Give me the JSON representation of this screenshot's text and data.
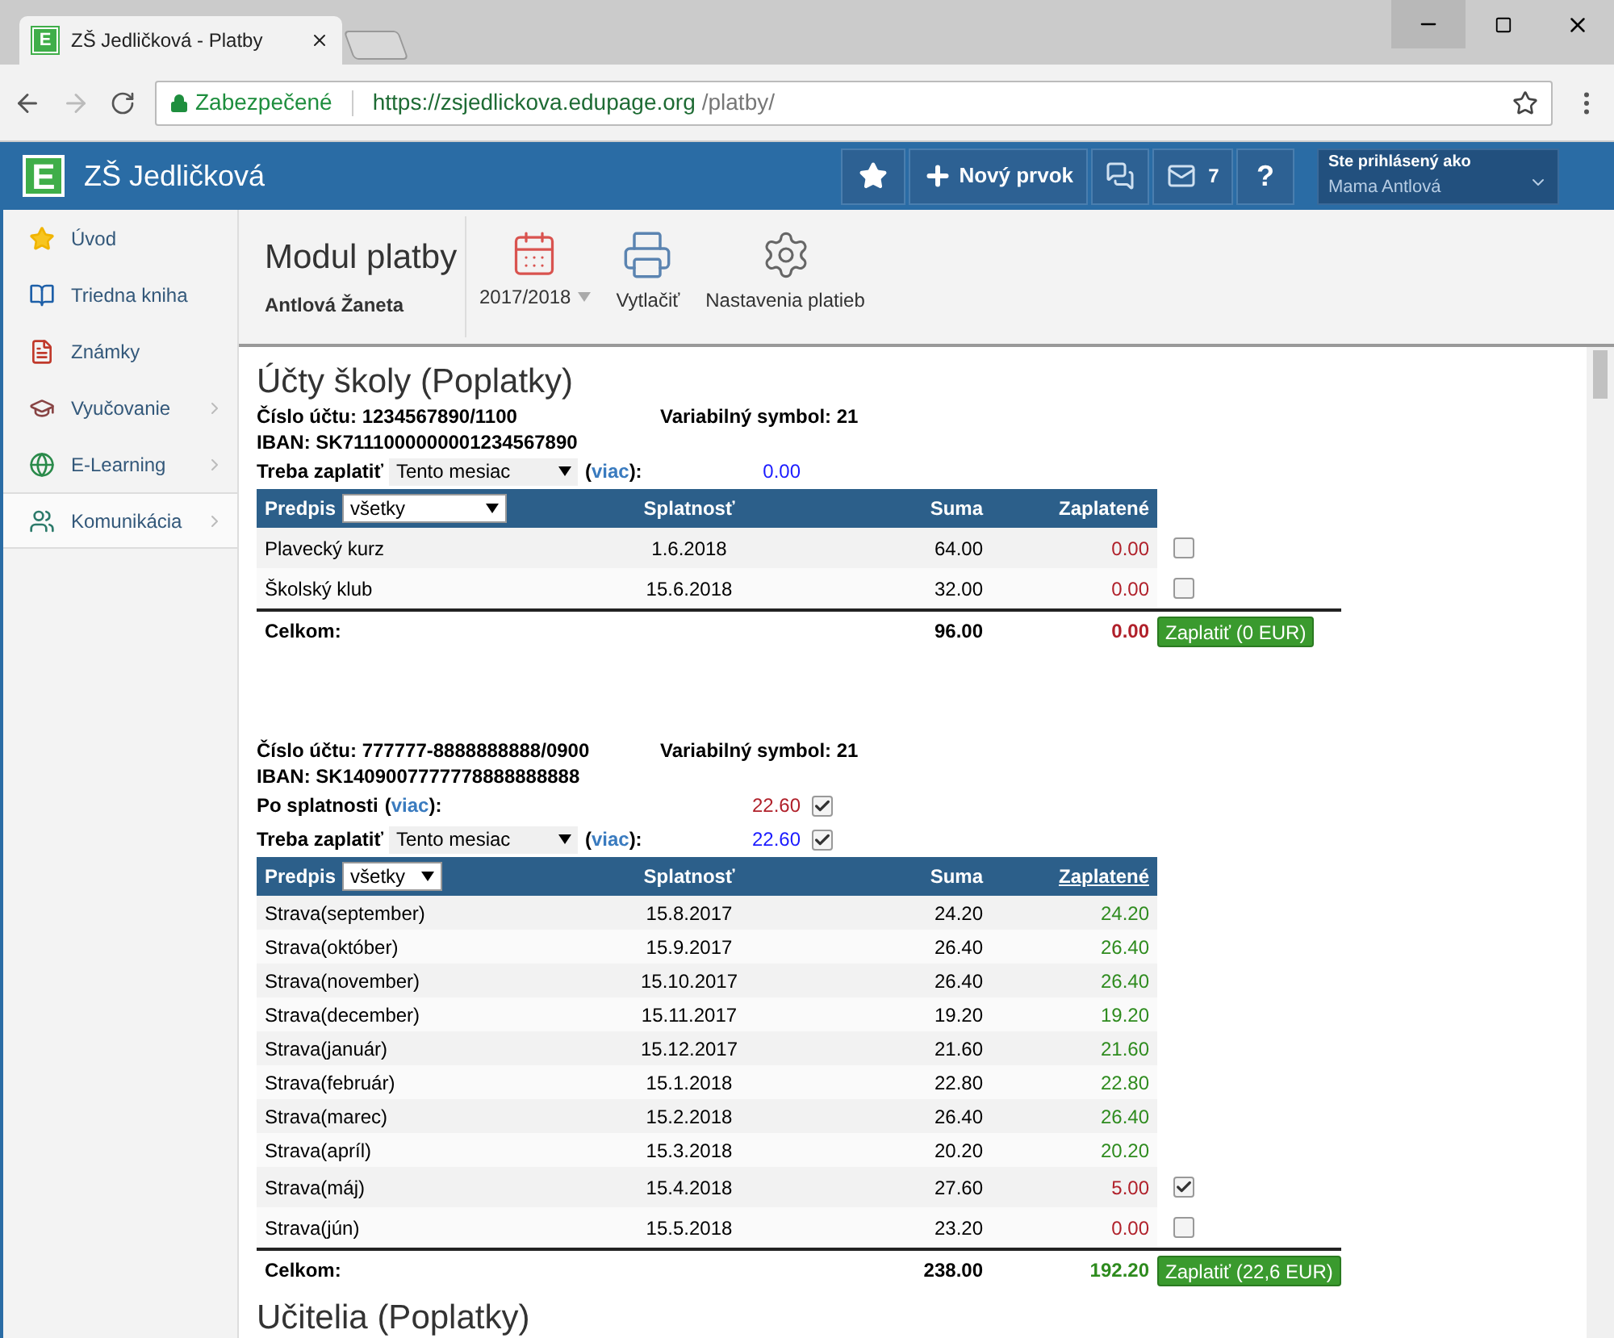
{
  "browser": {
    "tab_logo": "E",
    "tab_title": "ZŠ Jedličková - Platby",
    "security": "Zabezpečené",
    "url_host": "https://zsjedlickova.edupage.org",
    "url_path": "/platby/"
  },
  "header": {
    "logo": "E",
    "school": "ZŠ Jedličková",
    "new_item": "Nový prvok",
    "messages_count": "7",
    "help": "?",
    "user_label": "Ste prihlásený ako",
    "user_name": "Mama Antlová"
  },
  "sidebar": {
    "items": [
      {
        "label": "Úvod",
        "kind": "star",
        "has_submenu": false,
        "selected": false
      },
      {
        "label": "Triedna kniha",
        "kind": "book",
        "has_submenu": false,
        "selected": false
      },
      {
        "label": "Známky",
        "kind": "grades",
        "has_submenu": false,
        "selected": false
      },
      {
        "label": "Vyučovanie",
        "kind": "teaching",
        "has_submenu": true,
        "selected": false
      },
      {
        "label": "E-Learning",
        "kind": "globe",
        "has_submenu": true,
        "selected": false
      },
      {
        "label": "Komunikácia",
        "kind": "people",
        "has_submenu": true,
        "selected": true
      }
    ]
  },
  "module": {
    "title": "Modul platby",
    "student": "Antlová Žaneta",
    "toolbar": [
      {
        "kind": "year",
        "label": "2017/2018"
      },
      {
        "kind": "print",
        "label": "Vytlačiť"
      },
      {
        "kind": "settings",
        "label": "Nastavenia platieb"
      }
    ]
  },
  "section_title": "Účty školy (Poplatky)",
  "accounts": [
    {
      "account": "Číslo účtu: 1234567890/1100",
      "variable_symbol": "Variabilný symbol: 21",
      "iban": "IBAN: SK7111000000001234567890",
      "lines": [
        {
          "kind": "select",
          "label": "Treba zaplatiť",
          "select": "Tento mesiac",
          "more_before": "(",
          "more": "viac",
          "more_after": "):",
          "amount": "0.00",
          "color": "#1a1aff"
        }
      ],
      "table": {
        "columns": [
          "Predpis",
          "Splatnosť",
          "Suma",
          "Zaplatené"
        ],
        "filter": "všetky",
        "filter_wide": true,
        "paid_link": false,
        "rows": [
          {
            "name": "Plavecký kurz",
            "due": "1.6.2018",
            "sum": "64.00",
            "paid": "0.00",
            "color": "#b0202a",
            "checked": false
          },
          {
            "name": "Školský klub",
            "due": "15.6.2018",
            "sum": "32.00",
            "paid": "0.00",
            "color": "#b0202a",
            "checked": false
          }
        ],
        "total": {
          "label": "Celkom:",
          "sum": "96.00",
          "paid": "0.00",
          "color": "#b0202a"
        },
        "pay_button": "Zaplatiť (0 EUR)"
      }
    },
    {
      "account": "Číslo účtu: 777777-8888888888/0900",
      "variable_symbol": "Variabilný symbol: 21",
      "iban": "IBAN: SK1409007777778888888888",
      "lines": [
        {
          "kind": "plain",
          "label": "Po splatnosti",
          "more_before": "(",
          "more": "viac",
          "more_after": "):",
          "amount": "22.60",
          "color": "#b0202a",
          "checked": true
        },
        {
          "kind": "select",
          "label": "Treba zaplatiť",
          "select": "Tento mesiac",
          "more_before": "(",
          "more": "viac",
          "more_after": "):",
          "amount": "22.60",
          "color": "#1a1aff",
          "checked": true
        }
      ],
      "table": {
        "columns": [
          "Predpis",
          "Splatnosť",
          "Suma",
          "Zaplatené"
        ],
        "filter": "všetky",
        "filter_wide": false,
        "paid_link": true,
        "rows": [
          {
            "name": "Strava(september)",
            "due": "15.8.2017",
            "sum": "24.20",
            "paid": "24.20",
            "color": "#2e8b1e"
          },
          {
            "name": "Strava(október)",
            "due": "15.9.2017",
            "sum": "26.40",
            "paid": "26.40",
            "color": "#2e8b1e"
          },
          {
            "name": "Strava(november)",
            "due": "15.10.2017",
            "sum": "26.40",
            "paid": "26.40",
            "color": "#2e8b1e"
          },
          {
            "name": "Strava(december)",
            "due": "15.11.2017",
            "sum": "19.20",
            "paid": "19.20",
            "color": "#2e8b1e"
          },
          {
            "name": "Strava(január)",
            "due": "15.12.2017",
            "sum": "21.60",
            "paid": "21.60",
            "color": "#2e8b1e"
          },
          {
            "name": "Strava(február)",
            "due": "15.1.2018",
            "sum": "22.80",
            "paid": "22.80",
            "color": "#2e8b1e"
          },
          {
            "name": "Strava(marec)",
            "due": "15.2.2018",
            "sum": "26.40",
            "paid": "26.40",
            "color": "#2e8b1e"
          },
          {
            "name": "Strava(apríl)",
            "due": "15.3.2018",
            "sum": "20.20",
            "paid": "20.20",
            "color": "#2e8b1e"
          },
          {
            "name": "Strava(máj)",
            "due": "15.4.2018",
            "sum": "27.60",
            "paid": "5.00",
            "color": "#b0202a",
            "checked": true
          },
          {
            "name": "Strava(jún)",
            "due": "15.5.2018",
            "sum": "23.20",
            "paid": "0.00",
            "color": "#b0202a",
            "checked": false
          }
        ],
        "total": {
          "label": "Celkom:",
          "sum": "238.00",
          "paid": "192.20",
          "color": "#2e8b1e"
        },
        "pay_button": "Zaplatiť (22,6 EUR)"
      }
    }
  ],
  "next_section_title": "Učitelia (Poplatky)"
}
